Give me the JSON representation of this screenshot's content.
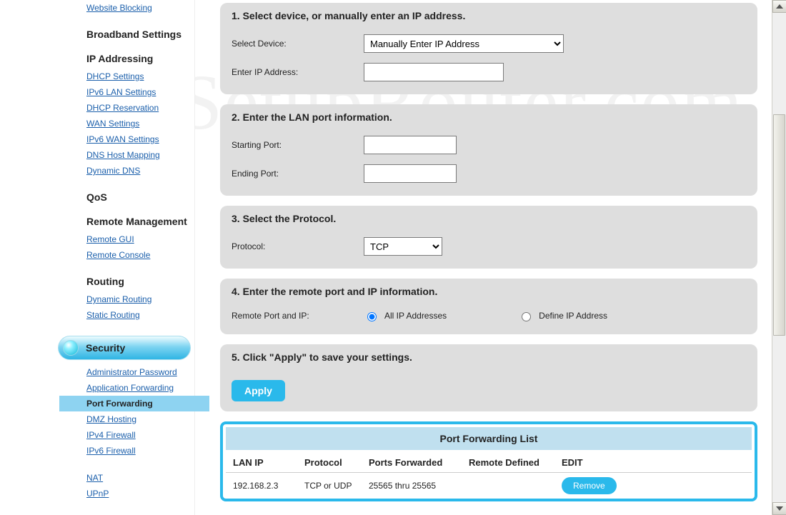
{
  "watermark": "SetupRouter.com",
  "sidebar": {
    "groups": [
      {
        "title": null,
        "items": [
          {
            "label": "Website Blocking",
            "active": false
          }
        ]
      },
      {
        "title": "Broadband Settings",
        "items": []
      },
      {
        "title": "IP Addressing",
        "items": [
          {
            "label": "DHCP Settings",
            "active": false
          },
          {
            "label": "IPv6 LAN Settings",
            "active": false
          },
          {
            "label": "DHCP Reservation",
            "active": false
          },
          {
            "label": "WAN Settings",
            "active": false
          },
          {
            "label": "IPv6 WAN Settings",
            "active": false
          },
          {
            "label": "DNS Host Mapping",
            "active": false
          },
          {
            "label": "Dynamic DNS",
            "active": false
          }
        ]
      },
      {
        "title": "QoS",
        "items": []
      },
      {
        "title": "Remote Management",
        "items": [
          {
            "label": "Remote GUI",
            "active": false
          },
          {
            "label": "Remote Console",
            "active": false
          }
        ]
      },
      {
        "title": "Routing",
        "items": [
          {
            "label": "Dynamic Routing",
            "active": false
          },
          {
            "label": "Static Routing",
            "active": false
          }
        ]
      }
    ],
    "security": {
      "title": "Security",
      "items": [
        {
          "label": "Administrator Password",
          "active": false
        },
        {
          "label": "Application Forwarding",
          "active": false
        },
        {
          "label": "Port Forwarding",
          "active": true
        },
        {
          "label": "DMZ Hosting",
          "active": false
        },
        {
          "label": "IPv4 Firewall",
          "active": false
        },
        {
          "label": "IPv6 Firewall",
          "active": false
        }
      ]
    },
    "tail": [
      {
        "label": "NAT",
        "active": false
      },
      {
        "label": "UPnP",
        "active": false
      }
    ]
  },
  "steps": {
    "s1": {
      "title": "1. Select device, or manually enter an IP address.",
      "row1_label": "Select Device:",
      "row1_select": "Manually Enter IP Address",
      "row2_label": "Enter IP Address:",
      "row2_value": ""
    },
    "s2": {
      "title": "2. Enter the LAN port information.",
      "row1_label": "Starting Port:",
      "row1_value": "",
      "row2_label": "Ending Port:",
      "row2_value": ""
    },
    "s3": {
      "title": "3. Select the Protocol.",
      "row1_label": "Protocol:",
      "row1_select": "TCP"
    },
    "s4": {
      "title": "4. Enter the remote port and IP information.",
      "row1_label": "Remote Port and IP:",
      "opt1": "All IP Addresses",
      "opt2": "Define IP Address",
      "selected": "opt1"
    },
    "s5": {
      "title": "5. Click \"Apply\" to save your settings.",
      "apply": "Apply"
    }
  },
  "pf_list": {
    "title": "Port Forwarding List",
    "headers": {
      "ip": "LAN IP",
      "proto": "Protocol",
      "ports": "Ports Forwarded",
      "remote": "Remote Defined",
      "edit": "EDIT"
    },
    "rows": [
      {
        "ip": "192.168.2.3",
        "proto": "TCP or UDP",
        "ports": "25565 thru 25565",
        "remote": "",
        "btn": "Remove"
      }
    ]
  }
}
